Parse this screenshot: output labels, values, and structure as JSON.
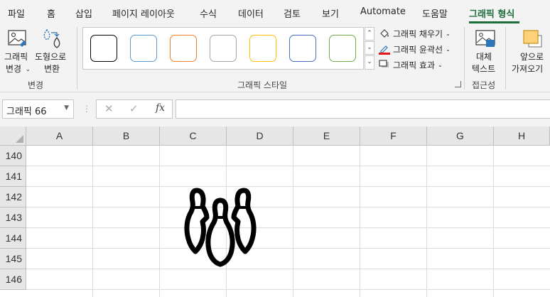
{
  "ribbon_tabs": [
    {
      "label": "파일",
      "active": false
    },
    {
      "label": "홈",
      "active": false
    },
    {
      "label": "삽입",
      "active": false
    },
    {
      "label": "페이지 레이아웃",
      "active": false
    },
    {
      "label": "수식",
      "active": false
    },
    {
      "label": "데이터",
      "active": false
    },
    {
      "label": "검토",
      "active": false
    },
    {
      "label": "보기",
      "active": false
    },
    {
      "label": "Automate",
      "active": false
    },
    {
      "label": "도움말",
      "active": false
    },
    {
      "label": "그래픽 형식",
      "active": true
    }
  ],
  "change_group": {
    "change_graphic_line1": "그래픽",
    "change_graphic_line2": "변경",
    "to_shape_line1": "도형으로",
    "to_shape_line2": "변환",
    "label": "변경"
  },
  "styles_group": {
    "swatch_colors": [
      "#000000",
      "#5b9bd5",
      "#ed7d31",
      "#a5a5a5",
      "#ffc000",
      "#4472c4",
      "#70ad47"
    ],
    "fill_label": "그래픽 채우기",
    "outline_label": "그래픽 윤곽선",
    "effects_label": "그래픽 효과",
    "label": "그래픽 스타일"
  },
  "accessibility_group": {
    "alt_text_line1": "대체",
    "alt_text_line2": "텍스트",
    "label": "접근성"
  },
  "arrange_group": {
    "bring_forward_line1": "앞으로",
    "bring_forward_line2": "가져오기"
  },
  "formula_bar": {
    "name_box": "그래픽 66",
    "cancel_glyph": "✕",
    "enter_glyph": "✓",
    "fx_glyph": "fx",
    "formula": ""
  },
  "grid": {
    "columns": [
      "A",
      "B",
      "C",
      "D",
      "E",
      "F",
      "G",
      "H"
    ],
    "rows": [
      "140",
      "141",
      "142",
      "143",
      "144",
      "145",
      "146"
    ]
  },
  "colors": {
    "accent": "#1e6e3c",
    "ribbon_bg": "#f3f3f3",
    "outline_red": "#e8151b"
  },
  "icons": {
    "selected_shape": "bowling-pins-icon"
  }
}
